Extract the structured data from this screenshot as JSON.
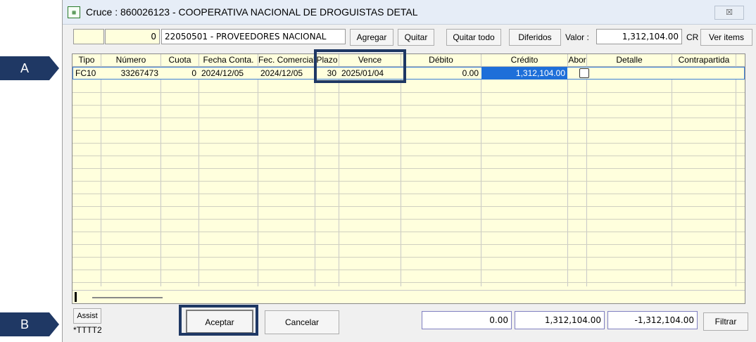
{
  "callouts": {
    "a": "A",
    "b": "B"
  },
  "window": {
    "icon_name": "spreadsheet-icon",
    "title": "Cruce : 860026123 - COOPERATIVA NACIONAL DE DROGUISTAS DETAL",
    "close_glyph": "☒"
  },
  "toolbar": {
    "count_value": "0",
    "account_value": "22050501 - PROVEEDORES NACIONAL",
    "agregar": "Agregar",
    "quitar": "Quitar",
    "quitar_todo": "Quitar todo",
    "diferidos": "Diferidos",
    "valor_label": "Valor :",
    "valor_value": "1,312,104.00",
    "cr_label": "CR",
    "ver_items": "Ver items"
  },
  "grid": {
    "columns": [
      "Tipo",
      "Número",
      "Cuota",
      "Fecha Conta.",
      "Fec. Comercial",
      "Plazo",
      "Vence",
      "Débito",
      "Crédito",
      "Abor",
      "Detalle",
      "Contrapartida"
    ],
    "row": {
      "tipo": "FC10",
      "numero": "33267473",
      "cuota": "0",
      "fecha_conta": "2024/12/05",
      "fec_comercial": "2024/12/05",
      "plazo": "30",
      "vence": "2025/01/04",
      "debito": "0.00",
      "credito": "1,312,104.00"
    }
  },
  "footer": {
    "assist": "Assist",
    "status": "*TTTT2",
    "aceptar": "Aceptar",
    "cancelar": "Cancelar",
    "total_debito": "0.00",
    "total_credito": "1,312,104.00",
    "diferencia": "-1,312,104.00",
    "filtrar": "Filtrar"
  },
  "colors": {
    "callout": "#1f3864",
    "grid_bg": "#ffffdd",
    "selection": "#1e6fd9"
  }
}
